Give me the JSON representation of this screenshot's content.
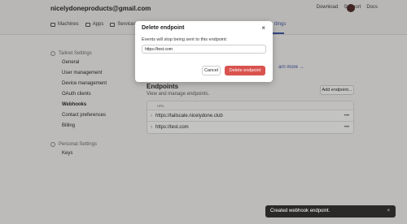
{
  "header": {
    "account": "nicelydoneproducts@gmail.com",
    "links": [
      "Download",
      "Support",
      "Docs"
    ]
  },
  "tabs": [
    {
      "label": "Machines",
      "icon": "machines-icon"
    },
    {
      "label": "Apps",
      "icon": "apps-icon"
    },
    {
      "label": "Services",
      "icon": "services-icon"
    }
  ],
  "active_tab_partial": "ttings",
  "sidebar": {
    "sections": [
      {
        "title": "Tailnet Settings",
        "icon": "gear-icon",
        "items": [
          "General",
          "User management",
          "Device management",
          "OAuth clients",
          "Webhooks",
          "Contact preferences",
          "Billing"
        ],
        "active": "Webhooks"
      },
      {
        "title": "Personal Settings",
        "icon": "person-icon",
        "items": [
          "Keys"
        ]
      }
    ]
  },
  "content": {
    "learn_more": "arn more →",
    "endpoints_title": "Endpoints",
    "endpoints_desc": "View and manage endpoints.",
    "add_button": "Add endpoint...",
    "table_header": "URL",
    "rows": [
      "https://tailscale.nicelydone.club",
      "https://test.com"
    ]
  },
  "dialog": {
    "title": "Delete endpoint",
    "close": "×",
    "message": "Events will stop being sent to this endpoint:",
    "input_value": "https://test.com",
    "cancel": "Cancel",
    "confirm": "Delete endpoint"
  },
  "toast": {
    "message": "Created webhook endpoint.",
    "close": "×"
  },
  "colors": {
    "accent": "#3a4fa8",
    "danger": "#d9534f"
  }
}
